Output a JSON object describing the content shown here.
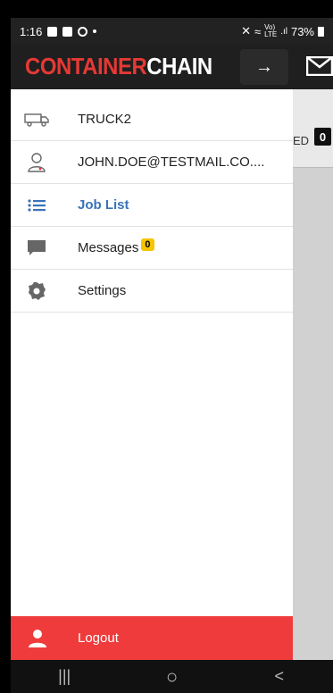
{
  "status_bar": {
    "time": "1:16",
    "battery": "73%",
    "network_top": "Vo)",
    "network_bottom": "LTE"
  },
  "header": {
    "logo_red": "CONTAINER",
    "logo_white": "CHAIN",
    "arrow_label": "→"
  },
  "background": {
    "tab_partial_text": "ED",
    "tab_badge": "0"
  },
  "drawer": {
    "items": [
      {
        "label": "TRUCK2",
        "icon": "truck-icon"
      },
      {
        "label": "JOHN.DOE@TESTMAIL.CO....",
        "icon": "user-icon"
      },
      {
        "label": "Job List",
        "icon": "list-icon",
        "active": true
      },
      {
        "label": "Messages",
        "icon": "chat-icon",
        "badge": "0"
      },
      {
        "label": "Settings",
        "icon": "gear-icon"
      }
    ],
    "logout_label": "Logout"
  },
  "nav": {
    "recent": "|||",
    "home": "○",
    "back": "<"
  },
  "colors": {
    "accent": "#3a73b8",
    "logout": "#ef3b3b",
    "brand_red": "#e53935",
    "badge_yellow": "#f5c400"
  }
}
